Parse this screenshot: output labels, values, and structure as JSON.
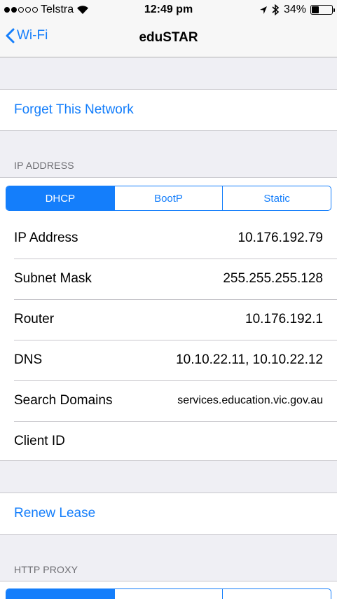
{
  "status_bar": {
    "carrier": "Telstra",
    "time": "12:49 pm",
    "battery": "34%",
    "battery_level": 0.34
  },
  "nav": {
    "back_label": "Wi-Fi",
    "title": "eduSTAR"
  },
  "forget_network": "Forget This Network",
  "ip_section": {
    "header": "IP ADDRESS",
    "segments": [
      "DHCP",
      "BootP",
      "Static"
    ],
    "selected": "DHCP",
    "rows": [
      {
        "label": "IP Address",
        "value": "10.176.192.79"
      },
      {
        "label": "Subnet Mask",
        "value": "255.255.255.128"
      },
      {
        "label": "Router",
        "value": "10.176.192.1"
      },
      {
        "label": "DNS",
        "value": "10.10.22.11, 10.10.22.12"
      },
      {
        "label": "Search Domains",
        "value": "services.education.vic.gov.au"
      },
      {
        "label": "Client ID",
        "value": ""
      }
    ]
  },
  "renew_lease": "Renew Lease",
  "proxy_section": {
    "header": "HTTP PROXY"
  },
  "accent_color": "#147efb",
  "icons": [
    "wifi-icon",
    "location-arrow-icon",
    "bluetooth-icon",
    "battery-icon",
    "chevron-left-icon"
  ]
}
